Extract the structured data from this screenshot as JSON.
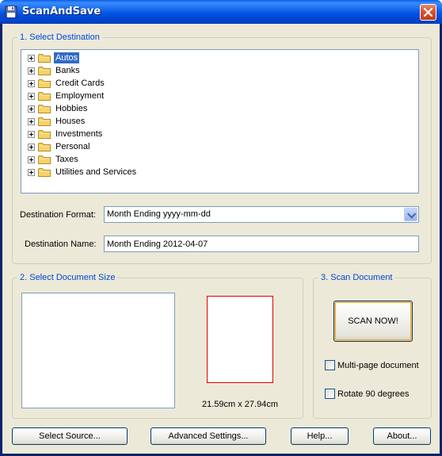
{
  "window": {
    "title": "ScanAndSave"
  },
  "destination": {
    "group_title": "1. Select Destination",
    "tree_items": [
      {
        "label": "Autos",
        "selected": true
      },
      {
        "label": "Banks",
        "selected": false
      },
      {
        "label": "Credit Cards",
        "selected": false
      },
      {
        "label": "Employment",
        "selected": false
      },
      {
        "label": "Hobbies",
        "selected": false
      },
      {
        "label": "Houses",
        "selected": false
      },
      {
        "label": "Investments",
        "selected": false
      },
      {
        "label": "Personal",
        "selected": false
      },
      {
        "label": "Taxes",
        "selected": false
      },
      {
        "label": "Utilities and Services",
        "selected": false
      }
    ],
    "format_label": "Destination Format:",
    "format_value": "Month Ending yyyy-mm-dd",
    "name_label": "Destination Name:",
    "name_value": "Month Ending 2012-04-07"
  },
  "document_size": {
    "group_title": "2. Select Document Size",
    "size_text": "21.59cm x 27.94cm"
  },
  "scan": {
    "group_title": "3. Scan Document",
    "scan_button": "SCAN NOW!",
    "multipage_label": "Multi-page document",
    "rotate_label": "Rotate 90 degrees"
  },
  "buttons": {
    "select_source": "Select Source...",
    "advanced_settings": "Advanced Settings...",
    "help": "Help...",
    "about": "About..."
  },
  "colors": {
    "titlebar": "#0054e3",
    "group_title": "#0046d5",
    "selection": "#316ac5",
    "paper_outline": "#e00000",
    "dialog_bg": "#ece9d8"
  },
  "icons": {
    "app": "floppy-disk-icon",
    "close": "close-icon",
    "folder": "folder-icon",
    "expander": "plus-expander-icon",
    "dropdown": "chevron-down-icon"
  }
}
